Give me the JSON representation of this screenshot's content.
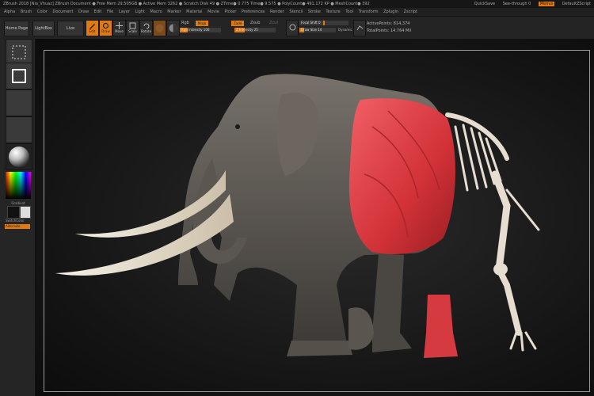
{
  "titlebar": {
    "text": "ZBrush 2018 [Nia_Vhuaz] ZBrush Document    ● Free Mem 29.505GB ● Active Mem 3262 ● Scratch Disk 49 ● ZTime● 0.775 Time● 9.575 ● PolyCount● 491.172 KP ● MeshCount● 392",
    "right": {
      "quicksave": "QuickSave",
      "seethrough": "See-through  0",
      "menus": "Menus",
      "script": "DefaultZScript"
    }
  },
  "menus": [
    "Alpha",
    "Brush",
    "Color",
    "Document",
    "Draw",
    "Edit",
    "File",
    "Layer",
    "Light",
    "Macro",
    "Marker",
    "Material",
    "Movie",
    "Picker",
    "Preferences",
    "Render",
    "Stencil",
    "Stroke",
    "Texture",
    "Tool",
    "Transform",
    "Zplugin",
    "Zscript"
  ],
  "toolbar": {
    "home": "Home Page",
    "lightbox": "LightBox",
    "live_boolean": "Live Boolean",
    "edit": "Edit",
    "draw": "Draw",
    "move": "Move",
    "scale": "Scale",
    "rotate": "Rotate",
    "rgb": "Rgb",
    "rgb_intensity": "Rgb Intensity 100",
    "mrgb": "Mrgb",
    "zadd": "Zadd",
    "zsub": "Zsub",
    "zcut": "Zcut",
    "z_intensity": "Z Intensity 25",
    "focal_shift": "Focal Shift 0",
    "draw_size": "Draw Size 14",
    "dynamic": "Dynamic",
    "active_points": "ActivePoints: 814,374",
    "total_points": "TotalPoints: 14.764 Mil"
  },
  "left": {
    "spotlight": "Spray Mask",
    "rect": "Rect",
    "alpha": "Alpha Off",
    "texture": "Texture Off",
    "material": "MatCap",
    "gradient": "Gradient",
    "switch_color": "SwitchColor",
    "alternate": "Alternate"
  },
  "colors": {
    "accent": "#e07a10",
    "bg": "#1c1c1c",
    "skin": "#5f5c58",
    "muscle": "#d9383d",
    "bone": "#e6ddd0",
    "tusk": "#ece6d8"
  }
}
